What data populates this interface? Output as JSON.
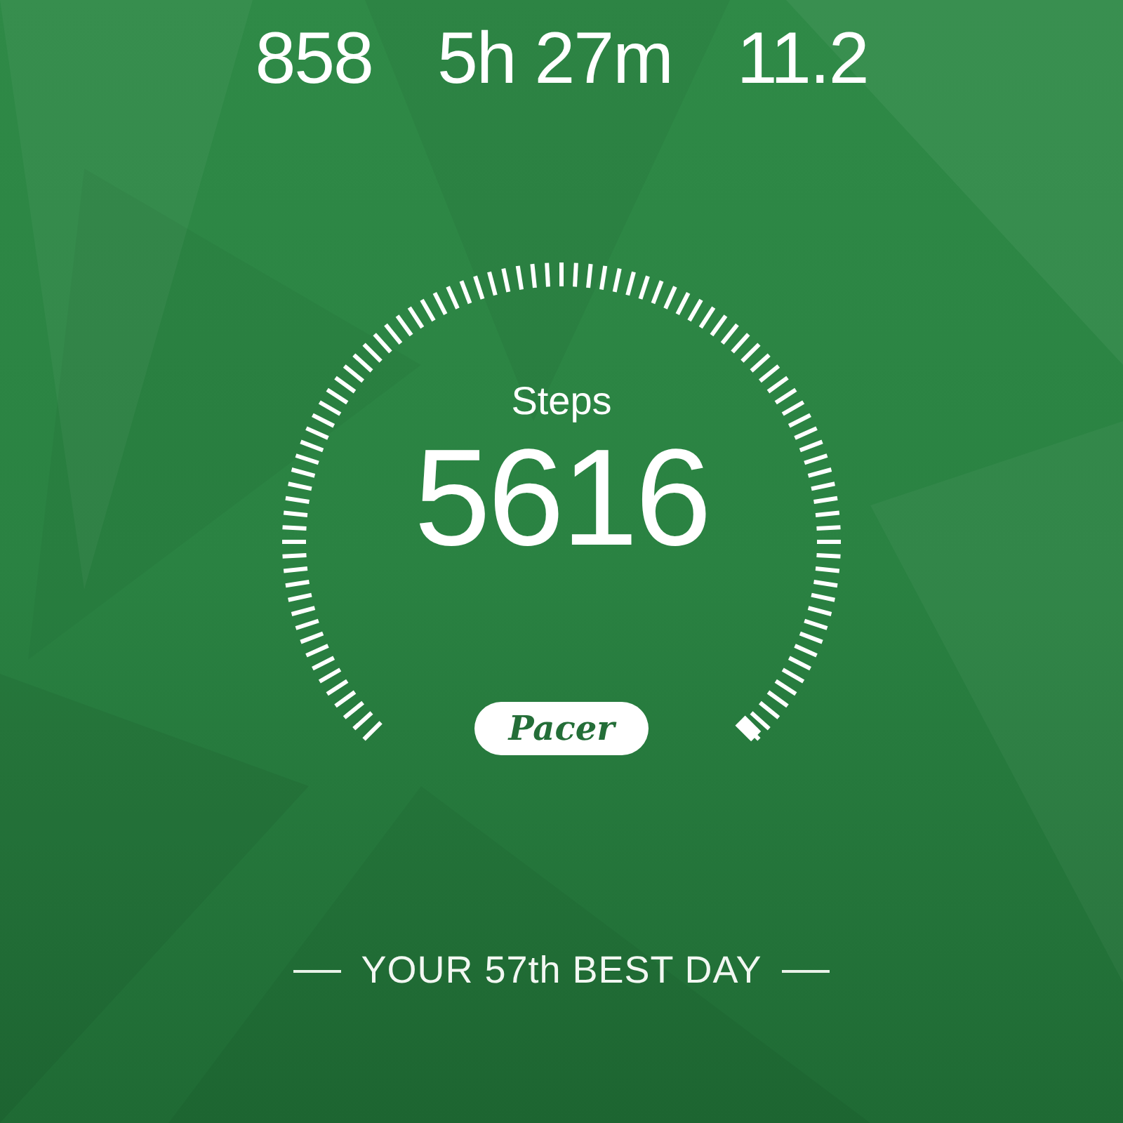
{
  "stats": [
    {
      "value": "858"
    },
    {
      "value": "5h 27m"
    },
    {
      "value": "11.2"
    }
  ],
  "gauge": {
    "label": "Steps",
    "value": "5616",
    "brand": "Pacer"
  },
  "rank": "YOUR 57th BEST DAY"
}
